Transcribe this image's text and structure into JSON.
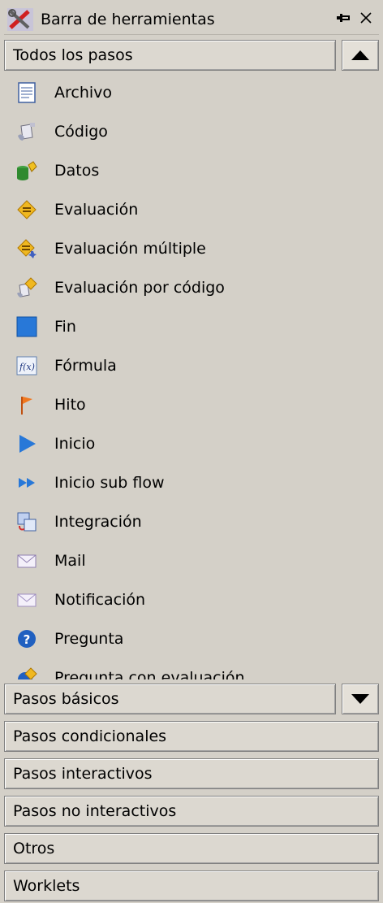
{
  "panel": {
    "title": "Barra de herramientas",
    "pin_icon": "pin-icon",
    "close_icon": "close-icon",
    "title_icon": "tools-icon"
  },
  "active_group": {
    "label": "Todos los pasos",
    "toggle_icon": "arrow-up-icon",
    "items": [
      {
        "label": "Archivo",
        "icon": "document-icon"
      },
      {
        "label": "Código",
        "icon": "code-icon"
      },
      {
        "label": "Datos",
        "icon": "database-icon"
      },
      {
        "label": "Evaluación",
        "icon": "evaluation-diamond-icon"
      },
      {
        "label": "Evaluación múltiple",
        "icon": "multiple-evaluation-icon"
      },
      {
        "label": "Evaluación por código",
        "icon": "code-evaluation-icon"
      },
      {
        "label": "Fin",
        "icon": "end-square-icon"
      },
      {
        "label": "Fórmula",
        "icon": "formula-icon"
      },
      {
        "label": "Hito",
        "icon": "flag-icon"
      },
      {
        "label": "Inicio",
        "icon": "play-icon"
      },
      {
        "label": "Inicio sub flow",
        "icon": "double-play-icon"
      },
      {
        "label": "Integración",
        "icon": "integration-icon"
      },
      {
        "label": "Mail",
        "icon": "mail-icon"
      },
      {
        "label": "Notificación",
        "icon": "notification-mail-icon"
      },
      {
        "label": "Pregunta",
        "icon": "question-icon"
      },
      {
        "label": "Pregunta con evaluación",
        "icon": "question-evaluation-icon"
      }
    ]
  },
  "groups": [
    {
      "label": "Pasos básicos",
      "toggle_icon": "arrow-down-icon"
    },
    {
      "label": "Pasos condicionales"
    },
    {
      "label": "Pasos interactivos"
    },
    {
      "label": "Pasos no interactivos"
    },
    {
      "label": "Otros"
    },
    {
      "label": "Worklets"
    }
  ],
  "colors": {
    "background": "#d4d0c8",
    "header": "#dcd8d0",
    "border": "#808080"
  }
}
